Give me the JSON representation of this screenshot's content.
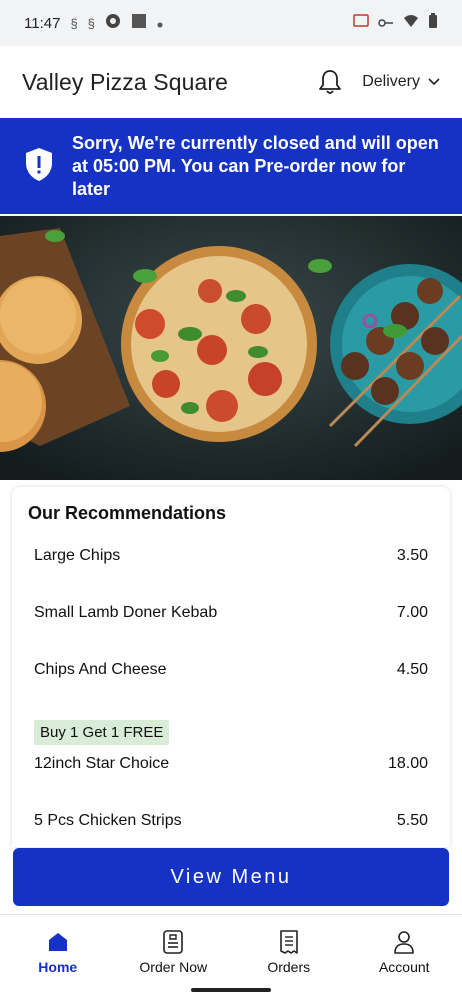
{
  "status": {
    "time": "11:47"
  },
  "header": {
    "title": "Valley Pizza Square",
    "delivery_label": "Delivery"
  },
  "banner": {
    "message": "Sorry, We're currently closed and will open at 05:00 PM. You can Pre-order now for later"
  },
  "recommendations": {
    "title": "Our Recommendations",
    "items": [
      {
        "name": "Large Chips",
        "price": "3.50"
      },
      {
        "name": "Small Lamb Doner Kebab",
        "price": "7.00"
      },
      {
        "name": "Chips And Cheese",
        "price": "4.50"
      },
      {
        "name": "12inch Star Choice",
        "price": "18.00",
        "promo": "Buy 1 Get 1 FREE"
      },
      {
        "name": "5 Pcs Chicken Strips",
        "price": "5.50"
      }
    ]
  },
  "cta": {
    "label": "View Menu"
  },
  "nav": {
    "items": [
      {
        "label": "Home",
        "icon": "home-icon",
        "active": true
      },
      {
        "label": "Order Now",
        "icon": "order-icon"
      },
      {
        "label": "Orders",
        "icon": "receipt-icon"
      },
      {
        "label": "Account",
        "icon": "user-icon"
      }
    ]
  },
  "colors": {
    "brand": "#1532c4",
    "promo_bg": "#d8ecd8"
  }
}
